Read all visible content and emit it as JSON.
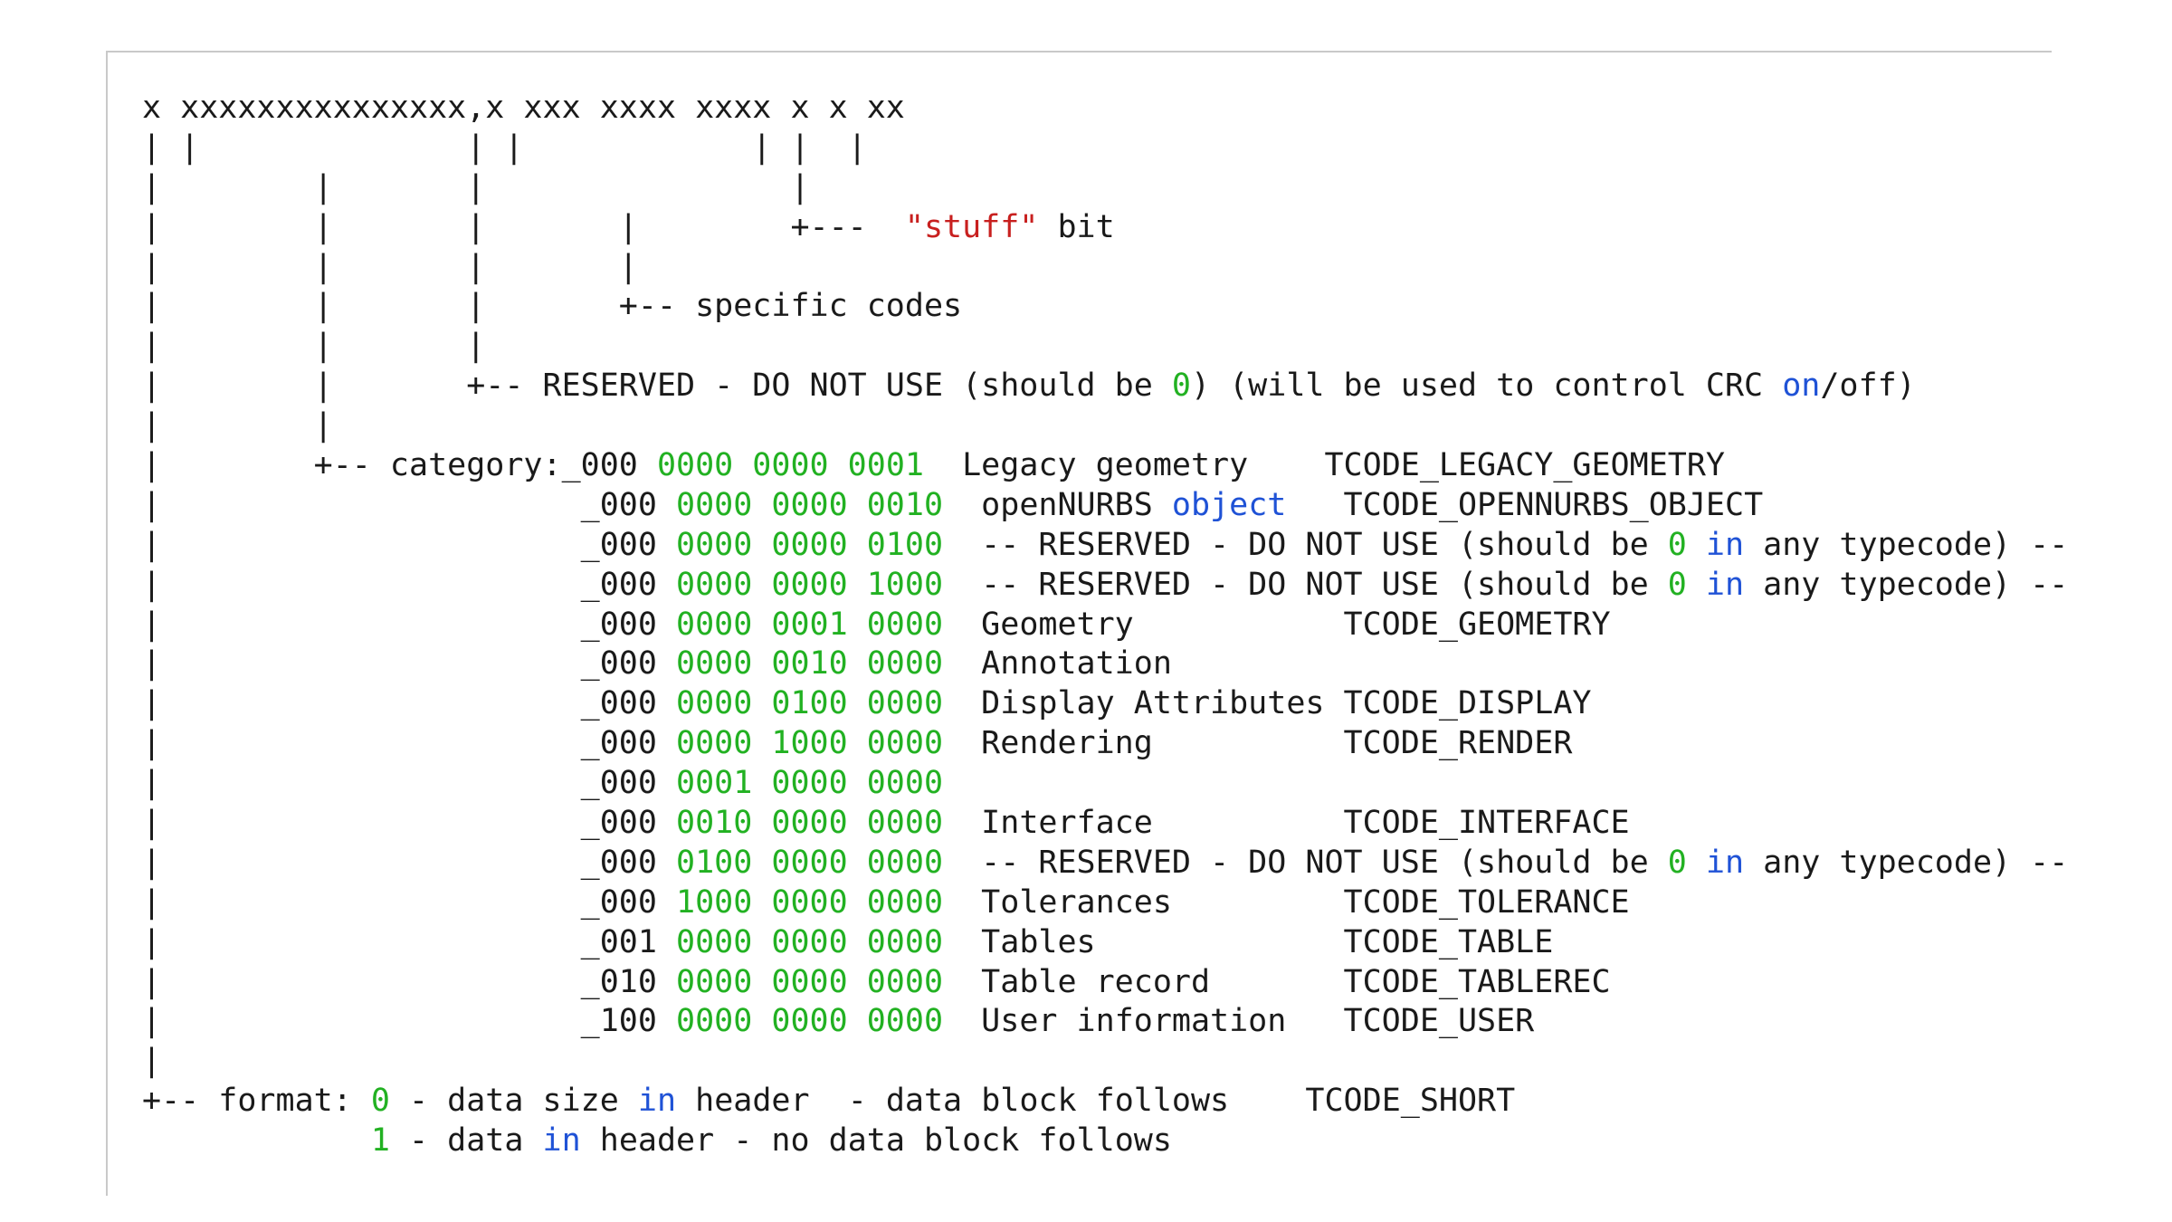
{
  "lines": [
    [
      {
        "t": "x xxxxxxxxxxxxxxx,x xxx xxxx xxxx x x xx",
        "c": ""
      }
    ],
    [
      {
        "t": "| |              | |            | |  |",
        "c": ""
      }
    ],
    [
      {
        "t": "|        |       |                |",
        "c": ""
      }
    ],
    [
      {
        "t": "|        |       |       |        +---  ",
        "c": ""
      },
      {
        "t": "\"stuff\"",
        "c": "red"
      },
      {
        "t": " bit",
        "c": ""
      }
    ],
    [
      {
        "t": "|        |       |       |",
        "c": ""
      }
    ],
    [
      {
        "t": "|        |       |       +-- specific codes",
        "c": ""
      }
    ],
    [
      {
        "t": "|        |       |",
        "c": ""
      }
    ],
    [
      {
        "t": "|        |       +-- RESERVED - DO NOT USE (should be ",
        "c": ""
      },
      {
        "t": "0",
        "c": "green"
      },
      {
        "t": ") (will be used to control CRC ",
        "c": ""
      },
      {
        "t": "on",
        "c": "blue"
      },
      {
        "t": "/off)",
        "c": ""
      }
    ],
    [
      {
        "t": "|        |",
        "c": ""
      }
    ],
    [
      {
        "t": "|        +-- category:_000 ",
        "c": ""
      },
      {
        "t": "0000 0000 0001",
        "c": "green"
      },
      {
        "t": "  Legacy geometry    TCODE_LEGACY_GEOMETRY",
        "c": ""
      }
    ],
    [
      {
        "t": "|                      _000 ",
        "c": ""
      },
      {
        "t": "0000 0000 0010",
        "c": "green"
      },
      {
        "t": "  openNURBS ",
        "c": ""
      },
      {
        "t": "object",
        "c": "blue"
      },
      {
        "t": "   TCODE_OPENNURBS_OBJECT",
        "c": ""
      }
    ],
    [
      {
        "t": "|                      _000 ",
        "c": ""
      },
      {
        "t": "0000 0000 0100",
        "c": "green"
      },
      {
        "t": "  -- RESERVED - DO NOT USE (should be ",
        "c": ""
      },
      {
        "t": "0",
        "c": "green"
      },
      {
        "t": " ",
        "c": ""
      },
      {
        "t": "in",
        "c": "blue"
      },
      {
        "t": " any typecode) --",
        "c": ""
      }
    ],
    [
      {
        "t": "|                      _000 ",
        "c": ""
      },
      {
        "t": "0000 0000 1000",
        "c": "green"
      },
      {
        "t": "  -- RESERVED - DO NOT USE (should be ",
        "c": ""
      },
      {
        "t": "0",
        "c": "green"
      },
      {
        "t": " ",
        "c": ""
      },
      {
        "t": "in",
        "c": "blue"
      },
      {
        "t": " any typecode) --",
        "c": ""
      }
    ],
    [
      {
        "t": "|                      _000 ",
        "c": ""
      },
      {
        "t": "0000 0001 0000",
        "c": "green"
      },
      {
        "t": "  Geometry           TCODE_GEOMETRY",
        "c": ""
      }
    ],
    [
      {
        "t": "|                      _000 ",
        "c": ""
      },
      {
        "t": "0000 0010 0000",
        "c": "green"
      },
      {
        "t": "  Annotation",
        "c": ""
      }
    ],
    [
      {
        "t": "|                      _000 ",
        "c": ""
      },
      {
        "t": "0000 0100 0000",
        "c": "green"
      },
      {
        "t": "  Display Attributes TCODE_DISPLAY",
        "c": ""
      }
    ],
    [
      {
        "t": "|                      _000 ",
        "c": ""
      },
      {
        "t": "0000 1000 0000",
        "c": "green"
      },
      {
        "t": "  Rendering          TCODE_RENDER",
        "c": ""
      }
    ],
    [
      {
        "t": "|                      _000 ",
        "c": ""
      },
      {
        "t": "0001 0000 0000",
        "c": "green"
      }
    ],
    [
      {
        "t": "|                      _000 ",
        "c": ""
      },
      {
        "t": "0010 0000 0000",
        "c": "green"
      },
      {
        "t": "  Interface          TCODE_INTERFACE",
        "c": ""
      }
    ],
    [
      {
        "t": "|                      _000 ",
        "c": ""
      },
      {
        "t": "0100 0000 0000",
        "c": "green"
      },
      {
        "t": "  -- RESERVED - DO NOT USE (should be ",
        "c": ""
      },
      {
        "t": "0",
        "c": "green"
      },
      {
        "t": " ",
        "c": ""
      },
      {
        "t": "in",
        "c": "blue"
      },
      {
        "t": " any typecode) --",
        "c": ""
      }
    ],
    [
      {
        "t": "|                      _000 ",
        "c": ""
      },
      {
        "t": "1000 0000 0000",
        "c": "green"
      },
      {
        "t": "  Tolerances         TCODE_TOLERANCE",
        "c": ""
      }
    ],
    [
      {
        "t": "|                      _001 ",
        "c": ""
      },
      {
        "t": "0000 0000 0000",
        "c": "green"
      },
      {
        "t": "  Tables             TCODE_TABLE",
        "c": ""
      }
    ],
    [
      {
        "t": "|                      _010 ",
        "c": ""
      },
      {
        "t": "0000 0000 0000",
        "c": "green"
      },
      {
        "t": "  Table record       TCODE_TABLEREC",
        "c": ""
      }
    ],
    [
      {
        "t": "|                      _100 ",
        "c": ""
      },
      {
        "t": "0000 0000 0000",
        "c": "green"
      },
      {
        "t": "  User information   TCODE_USER",
        "c": ""
      }
    ],
    [
      {
        "t": "|",
        "c": ""
      }
    ],
    [
      {
        "t": "+-- format: ",
        "c": ""
      },
      {
        "t": "0",
        "c": "green"
      },
      {
        "t": " - data size ",
        "c": ""
      },
      {
        "t": "in",
        "c": "blue"
      },
      {
        "t": " header  - data block follows    TCODE_SHORT",
        "c": ""
      }
    ],
    [
      {
        "t": "            ",
        "c": ""
      },
      {
        "t": "1",
        "c": "green"
      },
      {
        "t": " - data ",
        "c": ""
      },
      {
        "t": "in",
        "c": "blue"
      },
      {
        "t": " header - no data block follows",
        "c": ""
      }
    ]
  ],
  "colors": {
    "text": "#1a1a1a",
    "green": "#22b122",
    "blue": "#1f52d6",
    "red": "#c8201f",
    "border": "#c9c9c9"
  }
}
